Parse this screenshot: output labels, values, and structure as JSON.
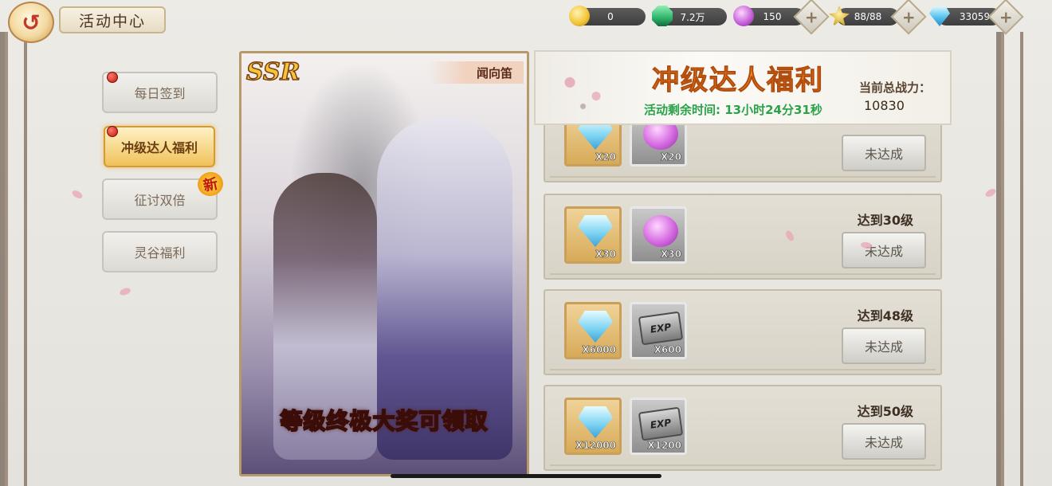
{
  "header": {
    "title": "活动中心",
    "back_label": "↺",
    "resources": [
      {
        "name": "gold",
        "icon": "gold-coin-icon",
        "value": "0",
        "color": "#f1c232"
      },
      {
        "name": "jade",
        "icon": "green-gem-icon",
        "value": "7.2万",
        "color": "#2fb36b"
      },
      {
        "name": "orb",
        "icon": "purple-orb-icon",
        "value": "150",
        "color": "#c25bd6"
      },
      {
        "name": "stamina",
        "icon": "stamina-icon",
        "value": "88/88",
        "color": "#d9b23a"
      },
      {
        "name": "diamond",
        "icon": "diamond-icon",
        "value": "33059",
        "color": "#59c3f0"
      }
    ],
    "plus_label": "+"
  },
  "sidebar": {
    "items": [
      {
        "label": "每日签到",
        "active": false,
        "red_dot": true
      },
      {
        "label": "冲级达人福利",
        "active": true,
        "red_dot": true
      },
      {
        "label": "征讨双倍",
        "active": false,
        "red_dot": false,
        "badge": "新"
      },
      {
        "label": "灵谷福利",
        "active": false,
        "red_dot": false
      }
    ]
  },
  "hero": {
    "rarity": "SSR",
    "name": "闻向笛",
    "caption": "等级终极大奖可领取"
  },
  "banner": {
    "title": "冲级达人福利",
    "timer_label": "活动剩余时间: 13小时24分31秒",
    "power_label": "当前总战力：",
    "power_value": "10830"
  },
  "rewards": [
    {
      "label": "",
      "items": [
        {
          "icon": "diamond-icon",
          "count": "X20",
          "frame": "gold"
        },
        {
          "icon": "purple-orb-icon",
          "count": "X20",
          "frame": "silver"
        }
      ],
      "button": "未达成"
    },
    {
      "label": "达到30级",
      "items": [
        {
          "icon": "diamond-icon",
          "count": "X30",
          "frame": "gold"
        },
        {
          "icon": "purple-orb-icon",
          "count": "X30",
          "frame": "silver"
        }
      ],
      "button": "未达成"
    },
    {
      "label": "达到48级",
      "items": [
        {
          "icon": "diamond-icon",
          "count": "X6000",
          "frame": "gold"
        },
        {
          "icon": "vip-exp-card-icon",
          "count": "X600",
          "frame": "silver",
          "card_text": "EXP"
        }
      ],
      "button": "未达成"
    },
    {
      "label": "达到50级",
      "items": [
        {
          "icon": "diamond-icon",
          "count": "X12000",
          "frame": "gold"
        },
        {
          "icon": "vip-exp-card-icon",
          "count": "X1200",
          "frame": "silver",
          "card_text": "EXP"
        }
      ],
      "button": "未达成"
    }
  ]
}
